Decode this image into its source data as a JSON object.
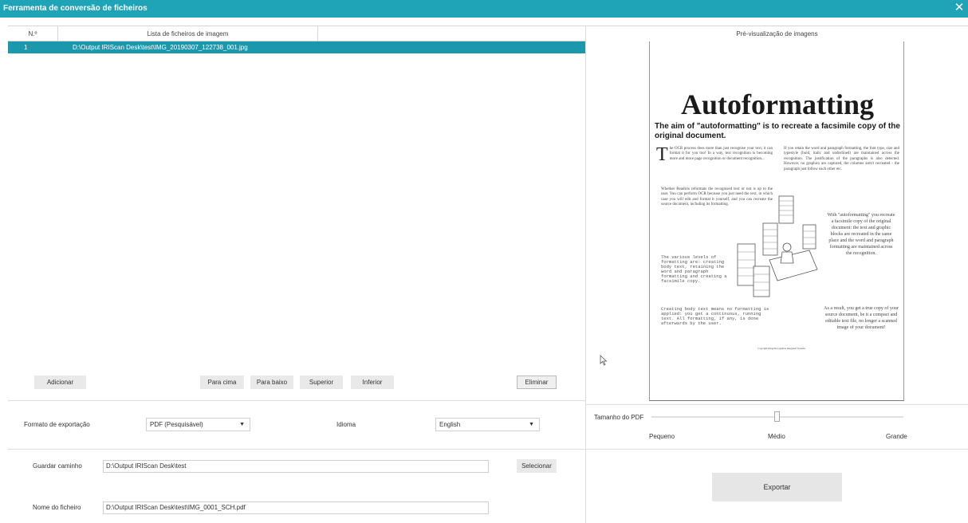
{
  "window": {
    "title": "Ferramenta de conversão de ficheiros",
    "close_glyph": "✕"
  },
  "file_list": {
    "columns": [
      "N.º",
      "Lista de ficheiros de imagem",
      ""
    ],
    "rows": [
      {
        "num": "1",
        "path": "D:\\Output IRIScan Desk\\test\\IMG_20190307_122738_001.jpg",
        "selected": true
      }
    ]
  },
  "list_buttons": {
    "add": "Adicionar",
    "up": "Para cima",
    "down": "Para baixo",
    "top": "Superior",
    "bottom": "Inferior",
    "delete": "Eliminar"
  },
  "export_format": {
    "label": "Formato de exportação",
    "value": "PDF (Pesquisável)"
  },
  "language": {
    "label": "Idioma",
    "value": "English"
  },
  "save_path": {
    "label": "Guardar caminho",
    "value": "D:\\Output IRIScan Desk\\test",
    "button": "Selecionar"
  },
  "file_name": {
    "label": "Nome do ficheiro",
    "value": "D:\\Output IRIScan Desk\\test\\IMG_0001_SCH.pdf"
  },
  "preview": {
    "title": "Pré-visualização de imagens",
    "doc": {
      "heading": "Autoformatting",
      "subheading": "The aim of \"autoformatting\" is to recreate a facsimile copy of the original document.",
      "col1_p1": "he OCR process does more than just recognise your text, it can format it for you too! In a way, text recognition is becoming more and more page recognition or document recognition...",
      "col1_p2": "Whether Readiris reformats the recognised text or not is up to the user. You can perform OCR because you just need the text, in which case you will edit and format it yourself, and you can recreate the source document, including its formatting.",
      "col1_mono1": "The various levels of formatting are: creating body text, retaining the word and paragraph formatting and creating a facsimile copy.",
      "col1_mono2": "Creating body text means no formatting is applied: you get a continuous, running text. All formatting, if any, is done afterwards by the user.",
      "col2_p1": "If you retain the word and paragraph formatting, the font type, size and typestyle (bold, italic and underlined) are maintained across the recognition. The justification of the paragraphs is also detected. However, no graphics are captured, the columns aren't recreated - the paragraph just follow each other etc.",
      "col2_p2": "With \"autoformatting\" you recreate a facsimile copy of the original document: the text and graphic blocks are recreated in the same place and the word and paragraph formatting are maintained across the recognition.",
      "col2_p3": "As a result, you get a true copy of your source document, be it a compact and editable text file, no longer a scanned image of your document!",
      "footer": "Copyright Image Recognition Integrated Systems"
    }
  },
  "pdf_size": {
    "label": "Tamanho do PDF",
    "level": 0.5,
    "ticks": [
      "Pequeno",
      "Médio",
      "Grande"
    ]
  },
  "export_button": "Exportar"
}
